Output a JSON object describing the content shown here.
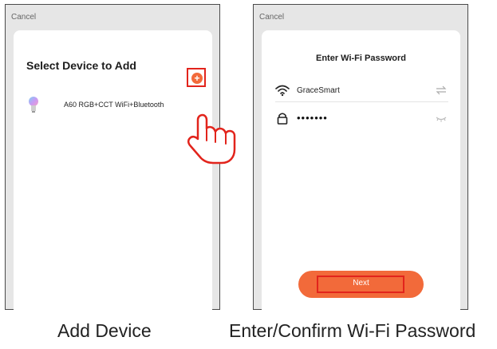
{
  "left_screen": {
    "cancel_label": "Cancel",
    "title": "Select Device to Add",
    "device": {
      "name": "A60 RGB+CCT WiFi+Bluetooth",
      "icon": "bulb-icon"
    },
    "add_button_glyph": "+"
  },
  "right_screen": {
    "cancel_label": "Cancel",
    "title": "Enter Wi-Fi Password",
    "ssid": "GraceSmart",
    "password_mask": "•••••••",
    "next_label": "Next"
  },
  "captions": {
    "left": "Add Device",
    "right": "Enter/Confirm Wi-Fi Password"
  },
  "colors": {
    "accent": "#f26a3a",
    "highlight": "#e2241c",
    "background": "#e6e6e6"
  }
}
